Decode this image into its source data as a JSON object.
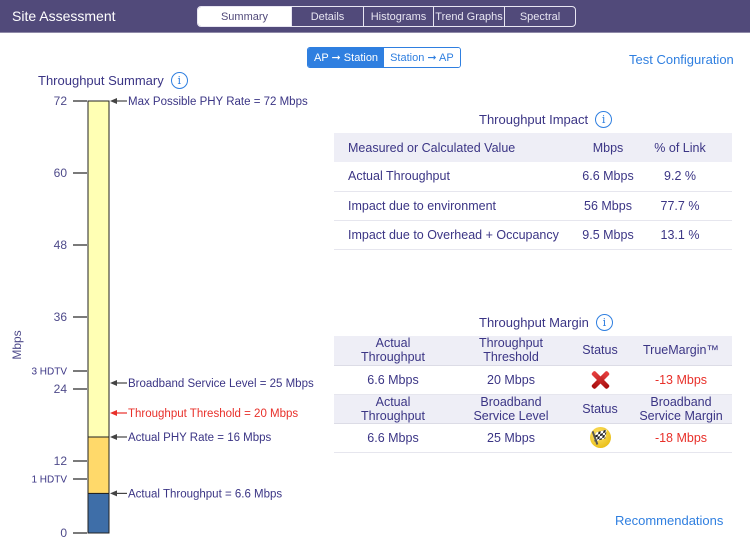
{
  "header": {
    "title": "Site Assessment",
    "tabs": [
      {
        "label": "Summary",
        "active": true
      },
      {
        "label": "Details",
        "active": false
      },
      {
        "label": "Histograms",
        "active": false
      },
      {
        "label": "Trend Graphs",
        "active": false
      },
      {
        "label": "Spectral",
        "active": false
      }
    ]
  },
  "direction": {
    "options": [
      {
        "label": "AP ➞ Station",
        "active": true
      },
      {
        "label": "Station ➞ AP",
        "active": false
      }
    ]
  },
  "links": {
    "test_configuration": "Test Configuration",
    "recommendations": "Recommendations"
  },
  "summary": {
    "title": "Throughput Summary",
    "info_icon": "i"
  },
  "chart_data": {
    "type": "bar",
    "title": "Throughput Summary",
    "ylabel": "Mbps",
    "ylim": [
      0,
      72
    ],
    "yticks": [
      0,
      12,
      24,
      36,
      48,
      60,
      72
    ],
    "extra_ticks": [
      {
        "label": "3 HDTV",
        "value": 27
      },
      {
        "label": "1 HDTV",
        "value": 9
      }
    ],
    "segments": [
      {
        "name": "Actual Throughput",
        "from": 0,
        "to": 6.6,
        "color": "#3e6ea8"
      },
      {
        "name": "Actual PHY Rate",
        "from": 6.6,
        "to": 16,
        "color": "#ffd96a"
      },
      {
        "name": "Max Possible PHY Rate",
        "from": 16,
        "to": 72,
        "color": "#ffffb4"
      }
    ],
    "annotations": [
      {
        "text": "Max Possible PHY Rate = 72 Mbps",
        "value": 72,
        "color": "#3b3585"
      },
      {
        "text": "Broadband Service Level = 25 Mbps",
        "value": 25,
        "color": "#3b3585"
      },
      {
        "text": "Throughput Threshold = 20 Mbps",
        "value": 20,
        "color": "#e8302a"
      },
      {
        "text": "Actual PHY Rate = 16 Mbps",
        "value": 16,
        "color": "#3b3585"
      },
      {
        "text": "Actual Throughput = 6.6 Mbps",
        "value": 6.6,
        "color": "#3b3585"
      }
    ]
  },
  "impact": {
    "title": "Throughput Impact",
    "headers": [
      "Measured or Calculated Value",
      "Mbps",
      "% of Link"
    ],
    "rows": [
      {
        "label": "Actual Throughput",
        "mbps": "6.6 Mbps",
        "pct": "9.2 %"
      },
      {
        "label": "Impact due to environment",
        "mbps": "56 Mbps",
        "pct": "77.7 %"
      },
      {
        "label": "Impact due to Overhead + Occupancy",
        "mbps": "9.5 Mbps",
        "pct": "13.1 %"
      }
    ]
  },
  "margin": {
    "title": "Throughput Margin",
    "block1": {
      "headers": [
        "Actual\nThroughput",
        "Throughput\nThreshold",
        "Status",
        "TrueMargin™"
      ],
      "actual": "6.6 Mbps",
      "threshold": "20 Mbps",
      "status_icon": "fail-x-icon",
      "margin": "-13 Mbps"
    },
    "block2": {
      "headers": [
        "Actual\nThroughput",
        "Broadband\nService Level",
        "Status",
        "Broadband\nService Margin"
      ],
      "actual": "6.6 Mbps",
      "level": "25 Mbps",
      "status_icon": "checkered-flag-icon",
      "margin": "-18 Mbps"
    },
    "colors": {
      "negative": "#e8302a"
    }
  }
}
